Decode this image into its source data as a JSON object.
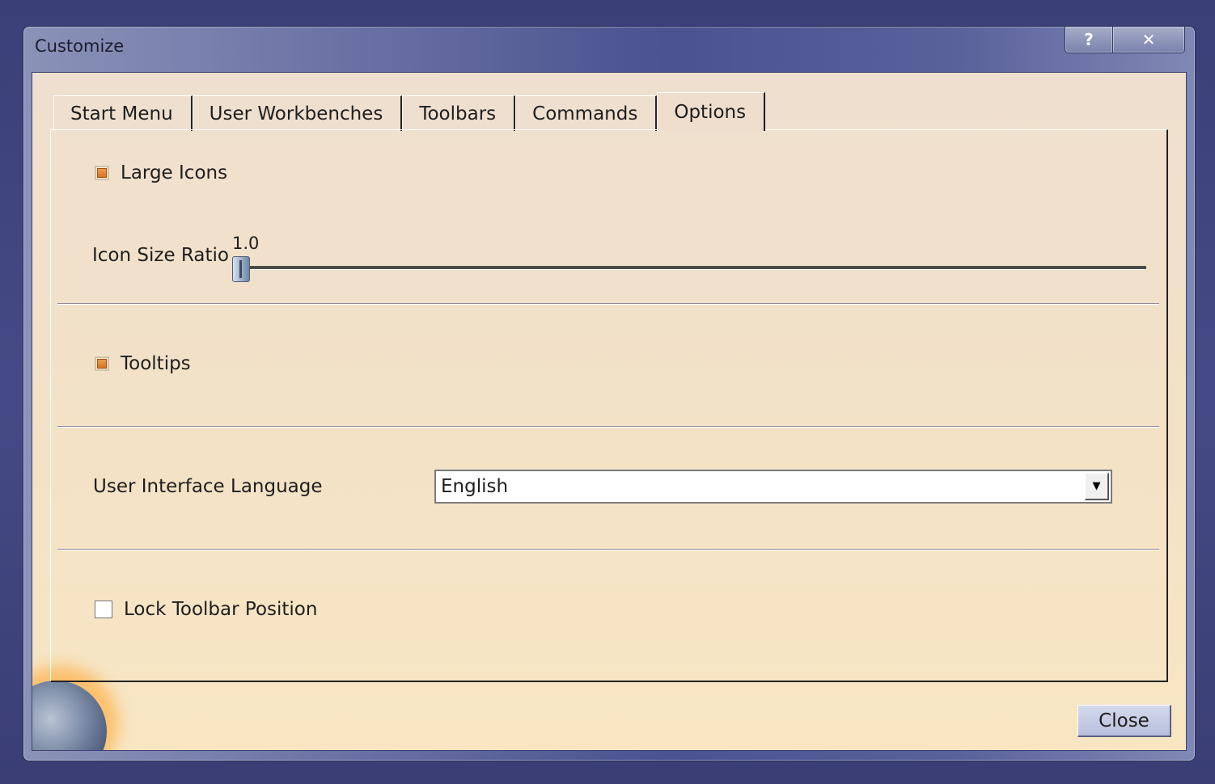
{
  "window": {
    "title": "Customize",
    "help_label": "?",
    "close_label": "✕"
  },
  "tabs": [
    {
      "label": "Start Menu"
    },
    {
      "label": "User Workbenches"
    },
    {
      "label": "Toolbars"
    },
    {
      "label": "Commands"
    },
    {
      "label": "Options",
      "active": true
    }
  ],
  "options": {
    "large_icons": {
      "label": "Large Icons",
      "checked": true
    },
    "icon_size_ratio": {
      "label": "Icon Size Ratio",
      "value": "1.0",
      "level": 0.0
    },
    "tooltips": {
      "label": "Tooltips",
      "checked": true
    },
    "language": {
      "label": "User Interface Language",
      "selected": "English"
    },
    "lock_toolbar": {
      "label": "Lock Toolbar Position",
      "checked": false
    }
  },
  "footer": {
    "close_button": "Close"
  },
  "colors": {
    "check_accent": "#d7701e",
    "panel_bg": "#f3e2c6",
    "title_bar": "#4a5290"
  }
}
